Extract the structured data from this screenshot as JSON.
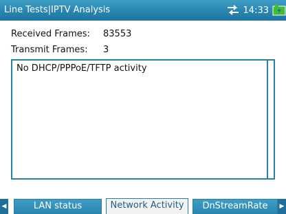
{
  "header": {
    "title": "Line Tests|IPTV Analysis",
    "time": "14:33",
    "icons": {
      "network": "network-transfer-icon",
      "battery": "battery-charging-icon"
    }
  },
  "stats": {
    "received_label": "Received Frames:",
    "received_value": "83553",
    "transmit_label": "Transmit Frames:",
    "transmit_value": "3"
  },
  "activity": {
    "message": "No DHCP/PPPoE/TFTP activity"
  },
  "tabs": [
    {
      "label": "LAN status",
      "active": false
    },
    {
      "label": "Network Activity",
      "active": true
    },
    {
      "label": "DnStreamRate",
      "active": false
    }
  ],
  "colors": {
    "header_blue": "#2a87b2",
    "border_blue": "#2a7fa8",
    "battery_green": "#3fbf2f"
  }
}
